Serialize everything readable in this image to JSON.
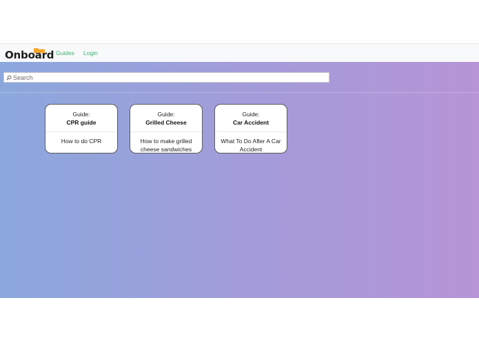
{
  "navbar": {
    "brand": "Onboard",
    "brand_color": "#1d1d1d",
    "brand_accent": "#f4a62a",
    "links": [
      {
        "label": "Guides"
      },
      {
        "label": "Login"
      }
    ],
    "link_color": "#3cb371"
  },
  "search": {
    "placeholder": "Search",
    "value": "",
    "icon": "search-icon"
  },
  "background_gradient": [
    "#8ba8dc",
    "#b694d6"
  ],
  "guides": [
    {
      "kicker": "Guide:",
      "title": "CPR guide",
      "description": "How to do CPR"
    },
    {
      "kicker": "Guide:",
      "title": "Grilled Cheese",
      "description": "How to make grilled cheese sandwiches"
    },
    {
      "kicker": "Guide:",
      "title": "Car Accident",
      "description": "What To Do After A Car Accident"
    }
  ]
}
